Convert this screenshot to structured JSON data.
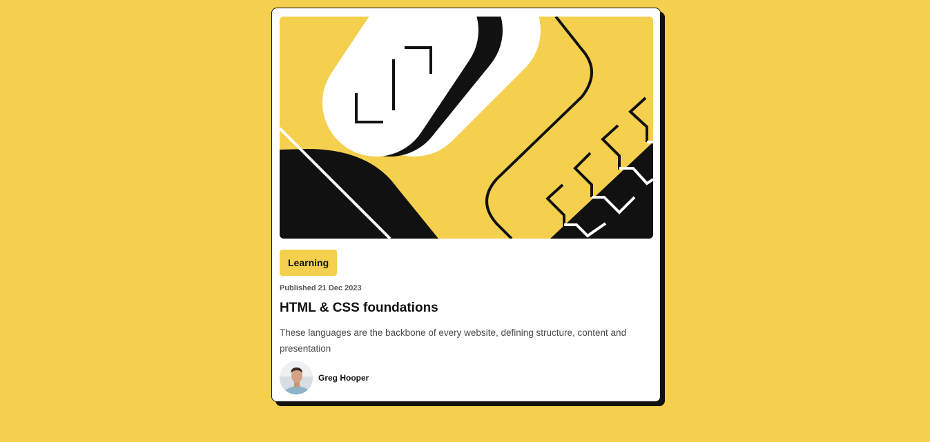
{
  "card": {
    "tag": "Learning",
    "published": "Published 21 Dec 2023",
    "title": "HTML & CSS foundations",
    "excerpt": "These languages are the backbone of every website, defining structure, content and presentation",
    "author": {
      "name": "Greg Hooper"
    },
    "hero_image": "abstract-illustration",
    "colors": {
      "accent": "#F4D04E",
      "ink": "#111111",
      "text_muted": "#4a4a4a"
    }
  }
}
